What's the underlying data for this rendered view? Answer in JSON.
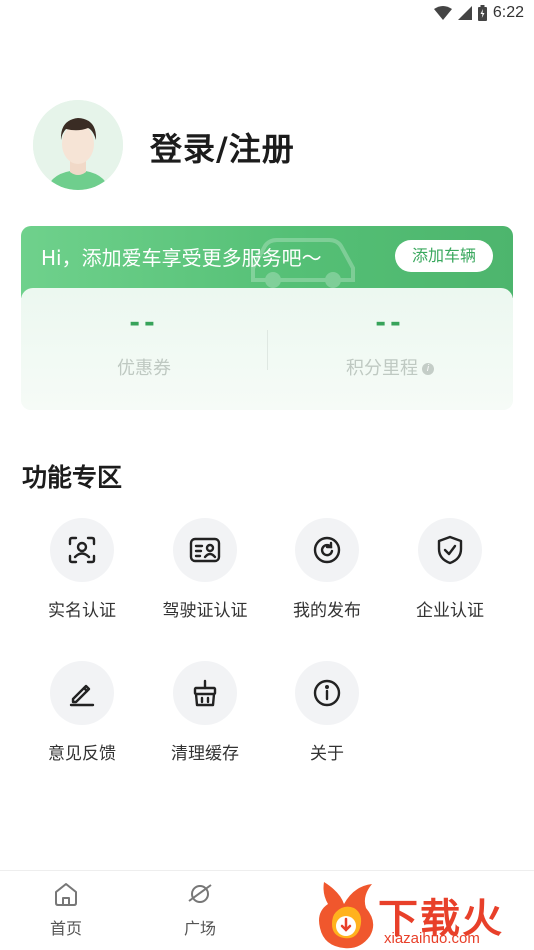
{
  "status_bar": {
    "time": "6:22"
  },
  "profile": {
    "login_title": "登录/注册"
  },
  "banner": {
    "text": "Hi，添加爱车享受更多服务吧〜",
    "add_car_label": "添加车辆"
  },
  "stats": [
    {
      "value": "--",
      "label": "优惠券"
    },
    {
      "value": "--",
      "label": "积分里程"
    }
  ],
  "features": {
    "title": "功能专区",
    "items": [
      {
        "label": "实名认证",
        "icon": "face-scan-icon"
      },
      {
        "label": "驾驶证认证",
        "icon": "id-card-icon"
      },
      {
        "label": "我的发布",
        "icon": "refresh-circle-icon"
      },
      {
        "label": "企业认证",
        "icon": "shield-check-icon"
      },
      {
        "label": "意见反馈",
        "icon": "pen-icon"
      },
      {
        "label": "清理缓存",
        "icon": "broom-basket-icon"
      },
      {
        "label": "关于",
        "icon": "info-icon"
      }
    ]
  },
  "bottom_nav": [
    {
      "label": "首页",
      "icon": "home-icon"
    },
    {
      "label": "广场",
      "icon": "planet-icon"
    }
  ],
  "watermark": {
    "text": "下载火",
    "sub": "xiazaihuo.com"
  },
  "colors": {
    "accent": "#37a35a",
    "banner": "#55c076",
    "watermark": "#e8402a"
  }
}
